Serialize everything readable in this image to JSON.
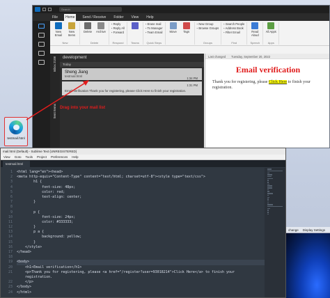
{
  "desktop": {
    "icon_label": "testmail.html"
  },
  "outlook": {
    "search_placeholder": "Search",
    "tabs": [
      "File",
      "Home",
      "Send / Receive",
      "Folder",
      "View",
      "Help"
    ],
    "ribbon": {
      "new_email": "New Email",
      "new_items": "New Items",
      "delete": "Delete",
      "archive": "Archive",
      "reply": "Reply",
      "reply_all": "Reply All",
      "forward": "Forward",
      "erase_mail": "Erase mail",
      "to_manager": "To Manager",
      "team_email": "Team Email",
      "move": "Move",
      "tags": "Tags",
      "new_group": "New Group",
      "browse_groups": "Browse Groups",
      "search_people": "Search People",
      "address_book": "Address Book",
      "filter_email": "Filter Email",
      "read_aloud": "Read Aloud",
      "all_apps": "All Apps",
      "group_new": "New",
      "group_delete": "Delete",
      "group_respond": "Respond",
      "group_teams": "Teams",
      "group_quick_steps": "Quick Steps",
      "group_groups": "Groups",
      "group_find": "Find",
      "group_speech": "Speech",
      "group_apps": "Apps"
    },
    "folder_inbox": "Inbox 2108",
    "folder_sent": "Sent Items",
    "list": {
      "title": "development",
      "group_today": "Today",
      "mails": [
        {
          "from": "Sheng Jiang",
          "to": "testmail.html",
          "time": "1:34 PM",
          "subject": "",
          "preview": ""
        },
        {
          "from": "",
          "to": "",
          "time": "1:31 PM",
          "subject": "Email verification",
          "preview": "Email verification  Thank you for registering, please Click Here to finish your registration."
        }
      ]
    },
    "reading": {
      "last_changed": "Last changed",
      "date": "Tuesday, September 20, 2022",
      "heading": "Email verification",
      "body_before": "Thank you for registering, please ",
      "link": "Click Here",
      "body_after": " to finish your registration."
    }
  },
  "annotation": {
    "text": "Drag into your mail list"
  },
  "sublime": {
    "title": "mail.html (Default) - Sublime Text (UNREGISTERED)",
    "menu": [
      "View",
      "Goto",
      "Tools",
      "Project",
      "Preferences",
      "Help"
    ],
    "tab": "testmail.html",
    "lines": [
      "<html lang=\"en\"><head>",
      "<meta http-equiv=\"Content-Type\" content=\"text/html; charset=utf-8\"><style type=\"text/css\">",
      "        h1 {",
      "            font-size: 48px;",
      "            color: red;",
      "            text-align: center;",
      "        }",
      "",
      "        p {",
      "            font-size: 24px;",
      "            color: #333333;",
      "        }",
      "        p a {",
      "            background: yellow;",
      "        }",
      "    </style>",
      "</head>",
      "",
      "<body>",
      "    <h1>Email verification</h1>",
      "    <p>Thank you for registering, please <a href=\"/register?user=93018214\">Click Here</a> to finish your",
      "    registration.",
      "    </p>",
      "</body>",
      "</html>"
    ],
    "line_numbers": [
      "1",
      "2",
      "3",
      "4",
      "5",
      "6",
      "7",
      "8",
      "9",
      "10",
      "11",
      "12",
      "13",
      "14",
      "15",
      "16",
      "17",
      "18",
      "19",
      "20",
      "21",
      "",
      "22",
      "23",
      "24"
    ]
  },
  "bottom_right": {
    "change": "change",
    "display_settings": "Display Settings"
  }
}
